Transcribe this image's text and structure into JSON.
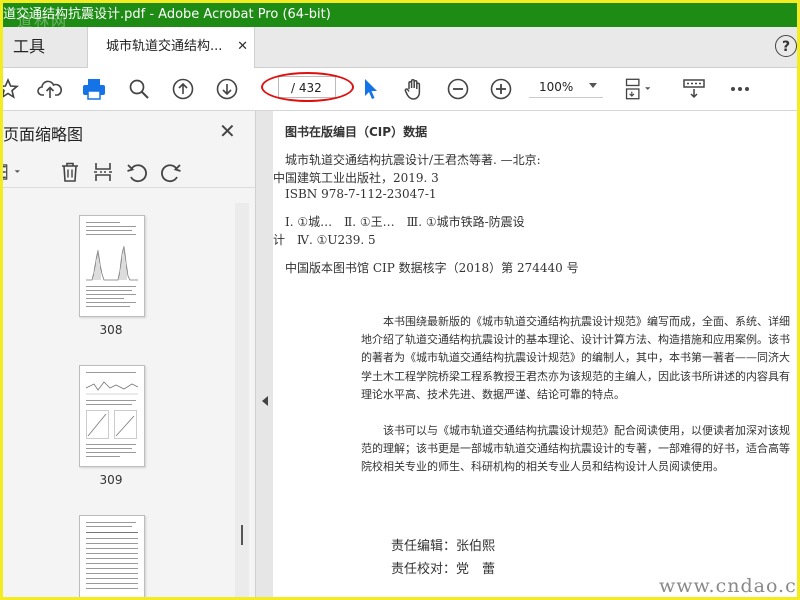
{
  "window": {
    "title": "道交通结构抗震设计.pdf - Adobe Acrobat Pro (64-bit)",
    "watermark": "道林网"
  },
  "tabs": {
    "tools_label": "工具",
    "doc_label": "城市轨道交通结构...",
    "close": "✕",
    "help": "?"
  },
  "toolbar": {
    "page_total": "/ 432",
    "zoom": "100%"
  },
  "sidebar": {
    "title": "页面缩略图",
    "close": "✕",
    "thumbnails": [
      {
        "page": "308"
      },
      {
        "page": "309"
      },
      {
        "page": ""
      }
    ]
  },
  "document": {
    "cip_heading": "图书在版编目（CIP）数据",
    "cip_lines": [
      "城市轨道交通结构抗震设计/王君杰等著. —北京:",
      "中国建筑工业出版社，2019. 3",
      "ISBN 978-7-112-23047-1",
      "Ⅰ. ①城…　Ⅱ. ①王…　Ⅲ. ①城市铁路-防震设",
      "计　Ⅳ. ①U239. 5"
    ],
    "cip_number": "中国版本图书馆 CIP 数据核字（2018）第 274440 号",
    "description_para1": "本书围绕最新版的《城市轨道交通结构抗震设计规范》编写而成，全面、系统、详细地介绍了轨道交通结构抗震设计的基本理论、设计计算方法、构造措施和应用案例。该书的著者为《城市轨道交通结构抗震设计规范》的编制人，其中，本书第一著者——同济大学土木工程学院桥梁工程系教授王君杰亦为该规范的主编人，因此该书所讲述的内容具有理论水平高、技术先进、数据严谨、结论可靠的特点。",
    "description_para2": "该书可以与《城市轨道交通结构抗震设计规范》配合阅读使用，以便读者加深对该规范的理解；该书更是一部城市轨道交通结构抗震设计的专著，一部难得的好书，适合高等院校相关专业的师生、科研机构的相关专业人员和结构设计人员阅读使用。",
    "editor": "责任编辑：张伯熙",
    "proofreader": "责任校对：党　蕾",
    "site_watermark": "www.cndao.com"
  },
  "colors": {
    "titlebar": "#1e8c14",
    "frame_border": "#f2ec21",
    "highlight_oval": "#e01010",
    "select_arrow": "#1473e6",
    "print_icon": "#1473e6"
  }
}
